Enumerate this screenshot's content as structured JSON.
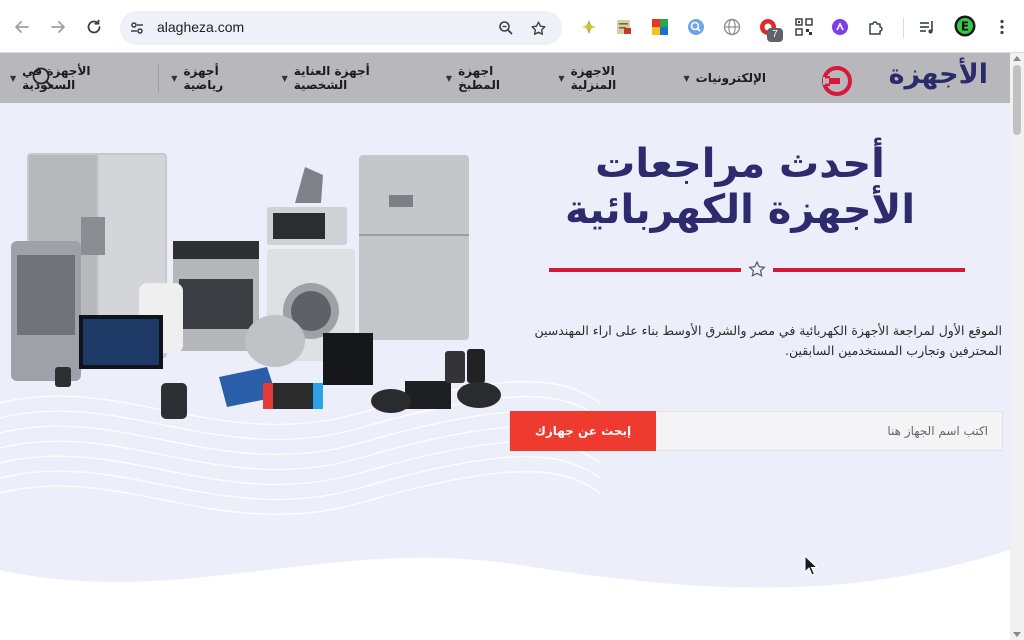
{
  "browser": {
    "url": "alagheza.com",
    "extension_badge": "7",
    "icons": [
      "back-icon",
      "forward-icon",
      "reload-icon",
      "site-info-icon",
      "zoom-icon",
      "bookmark-star-icon",
      "extensions-puzzle-icon",
      "media-controls-icon",
      "profile-avatar-icon",
      "more-menu-icon"
    ]
  },
  "site": {
    "logo_text": "الأجهزة",
    "brand_color": "#2b2a6b",
    "accent_color": "#d6193a",
    "nav": {
      "items": [
        {
          "label": "الإلكترونيات"
        },
        {
          "label": "الاجهزة المنزلية"
        },
        {
          "label": "اجهزة المطبخ"
        },
        {
          "label": "أجهزة العناية الشخصية"
        },
        {
          "label": "أجهزة رياضية"
        },
        {
          "label": "الأجهزة في السعودية"
        }
      ]
    }
  },
  "hero": {
    "title": "أحدث مراجعات الأجهزة الكهربائية",
    "description": "الموقع الأول لمراجعة الأجهزة الكهربائية في مصر والشرق الأوسط بناء على اراء المهندسين المحترفين وتجارب المستخدمين السابقين.",
    "search": {
      "placeholder": "اكتب اسم الجهاز هنا",
      "button_label": "إبحث عن جهازك",
      "button_color": "#ee3a2f"
    }
  }
}
